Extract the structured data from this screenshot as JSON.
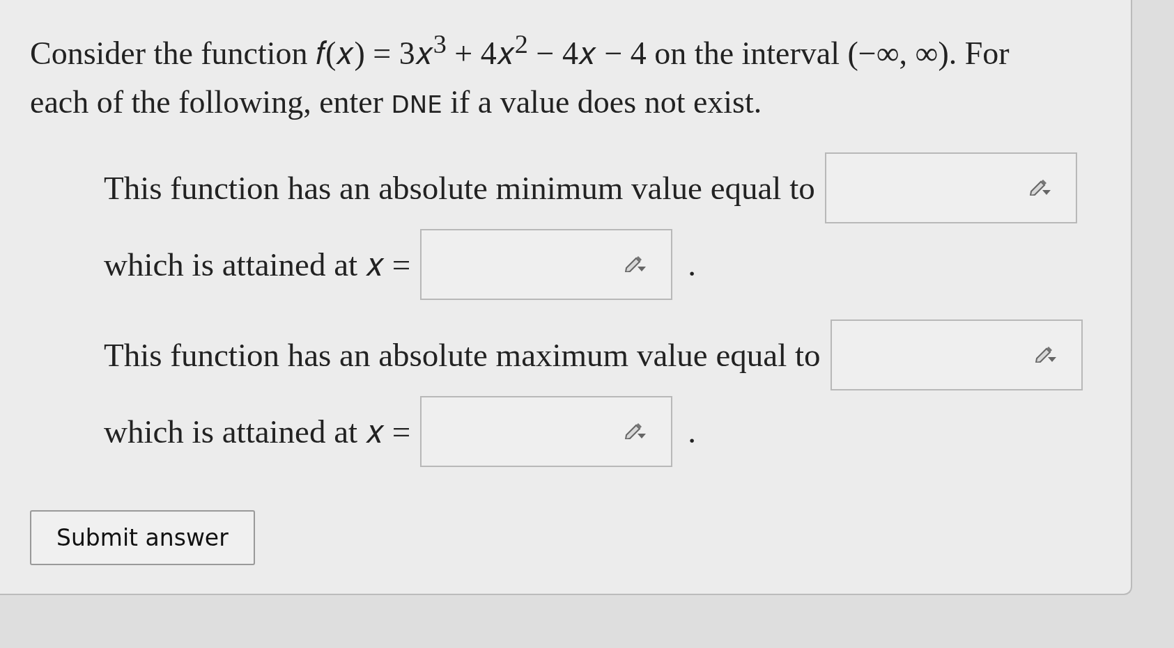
{
  "intro": {
    "text_before": "Consider the function 𝑓(𝑥) = 3𝑥$^{3}$ + 4𝑥$^{2}$ − 4𝑥 − 4 on the interval (−∞, ∞). For each of the following, enter ",
    "keyword": "DNE",
    "text_after": " if a value does not exist."
  },
  "prompts": [
    {
      "label": "This function has an absolute minimum value equal to"
    },
    {
      "label": "which is attained at 𝑥 =",
      "trailing": "."
    },
    {
      "label": "This function has an absolute maximum value equal to"
    },
    {
      "label": "which is attained at 𝑥 =",
      "trailing": "."
    }
  ],
  "submit_button": "Submit answer"
}
